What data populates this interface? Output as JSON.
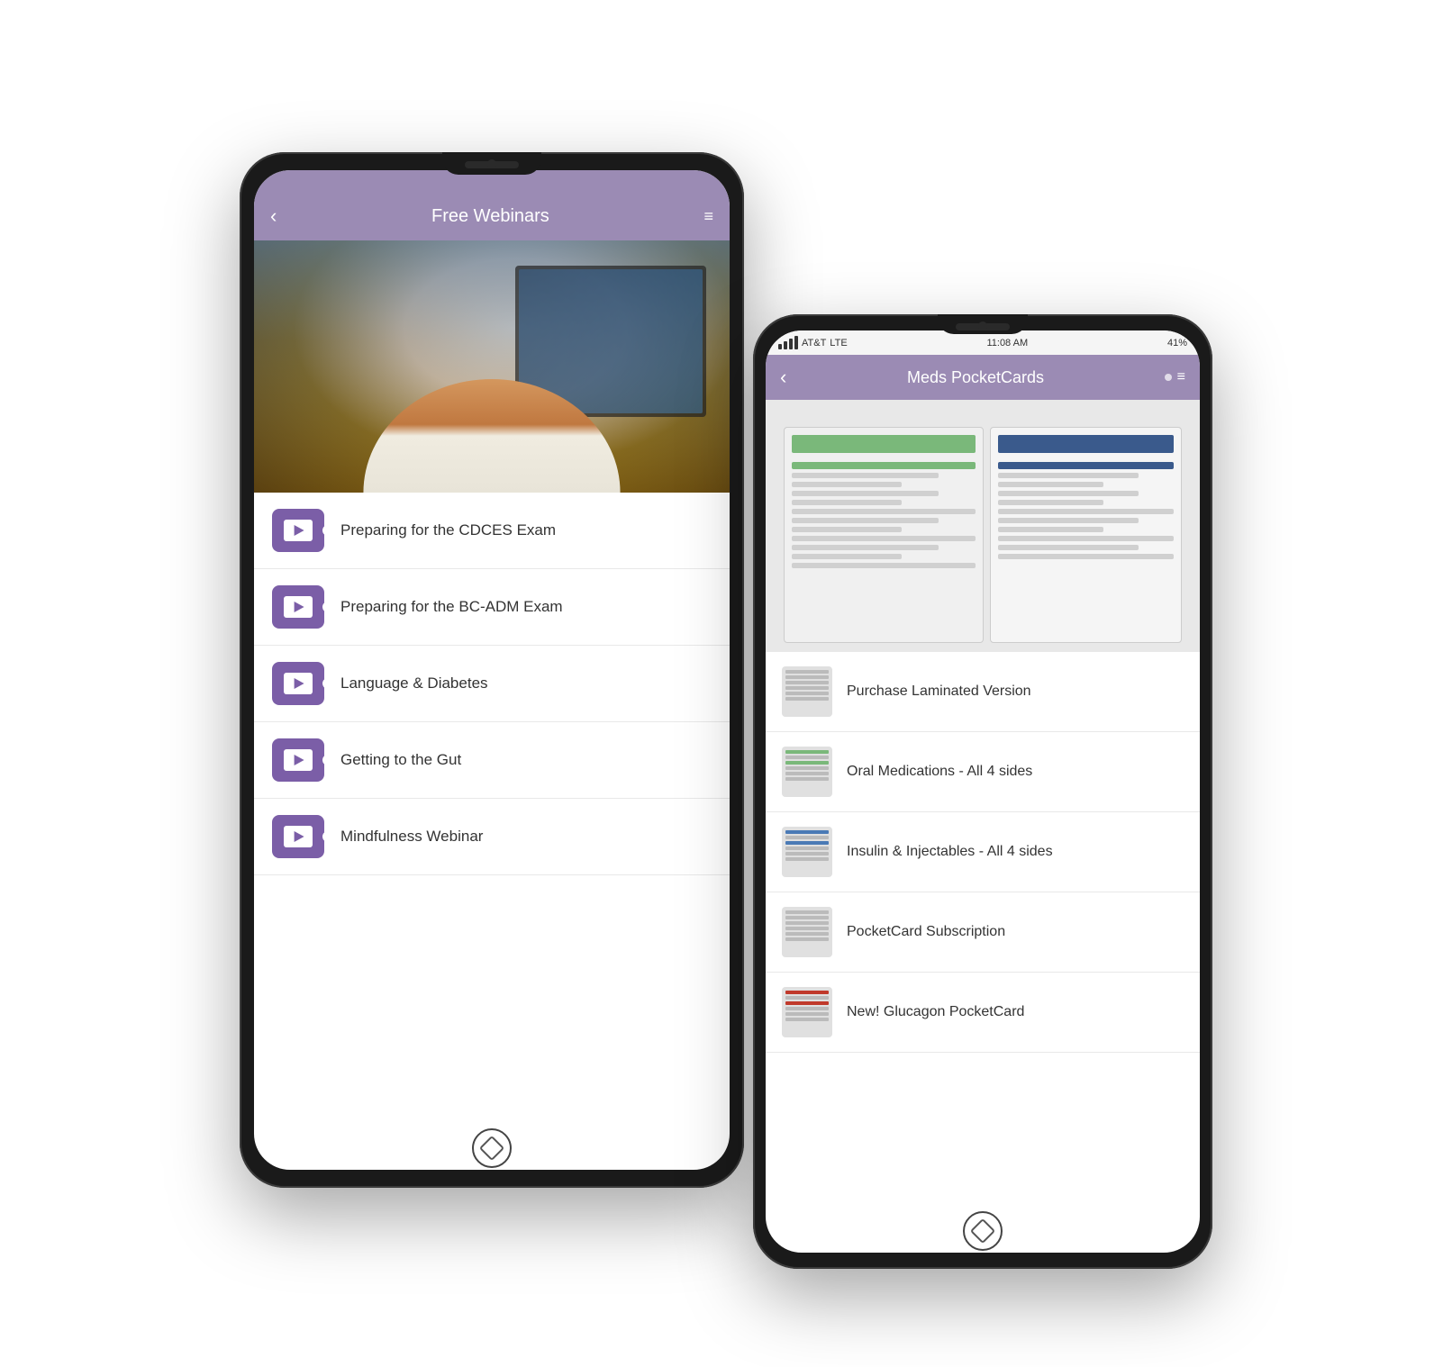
{
  "scene": {
    "background": "#ffffff"
  },
  "phone1": {
    "header": {
      "back_label": "‹",
      "title": "Free Webinars",
      "menu_icon": "≡"
    },
    "items": [
      {
        "id": 1,
        "label": "Preparing for the CDCES Exam"
      },
      {
        "id": 2,
        "label": "Preparing for the BC-ADM Exam"
      },
      {
        "id": 3,
        "label": "Language & Diabetes"
      },
      {
        "id": 4,
        "label": "Getting to the Gut"
      },
      {
        "id": 5,
        "label": "Mindfulness Webinar"
      }
    ]
  },
  "phone2": {
    "status_bar": {
      "carrier": "AT&T",
      "network": "LTE",
      "time": "11:08 AM",
      "battery": "41%"
    },
    "header": {
      "back_label": "‹",
      "title": "Meds PocketCards",
      "menu_icon": "≡"
    },
    "items": [
      {
        "id": 1,
        "label": "Purchase Laminated Version",
        "thumb_type": "plain"
      },
      {
        "id": 2,
        "label": "Oral Medications - All 4 sides",
        "thumb_type": "green"
      },
      {
        "id": 3,
        "label": "Insulin & Injectables - All 4 sides",
        "thumb_type": "blue"
      },
      {
        "id": 4,
        "label": "PocketCard Subscription",
        "thumb_type": "plain"
      },
      {
        "id": 5,
        "label": "New! Glucagon PocketCard",
        "thumb_type": "red"
      }
    ]
  }
}
